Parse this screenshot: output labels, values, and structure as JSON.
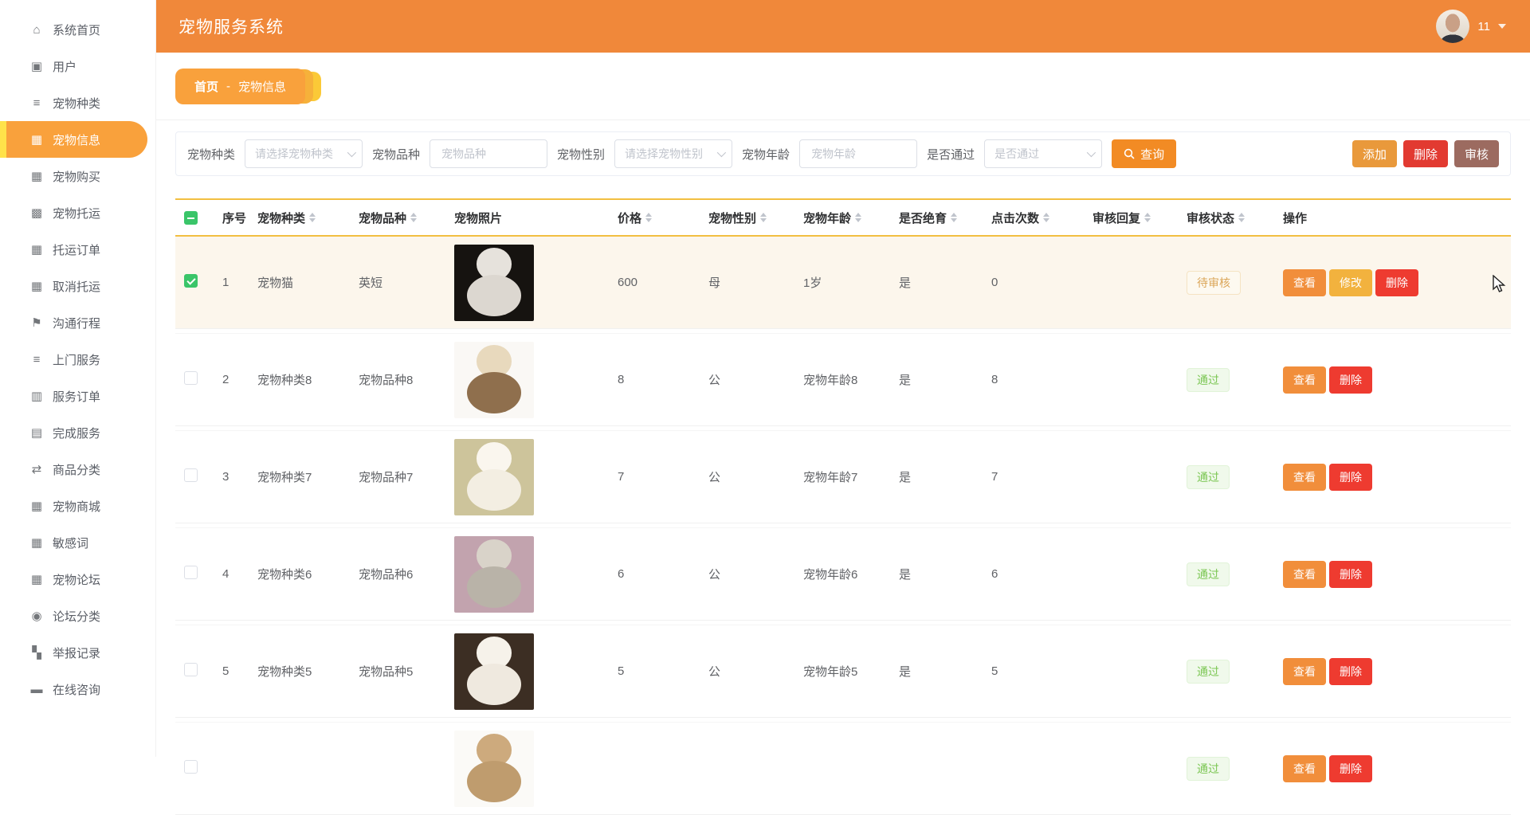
{
  "header": {
    "title": "宠物服务系统",
    "user_name": "11"
  },
  "sidebar": {
    "items": [
      {
        "id": "home",
        "label": "系统首页",
        "icon": "home-icon",
        "glyph": "⌂",
        "active": false
      },
      {
        "id": "users",
        "label": "用户",
        "icon": "user-icon",
        "glyph": "▣",
        "active": false
      },
      {
        "id": "pet-type",
        "label": "宠物种类",
        "icon": "list-icon",
        "glyph": "≡",
        "active": false
      },
      {
        "id": "pet-info",
        "label": "宠物信息",
        "icon": "grid-icon",
        "glyph": "▦",
        "active": true
      },
      {
        "id": "pet-purchase",
        "label": "宠物购买",
        "icon": "grid-icon",
        "glyph": "▦",
        "active": false
      },
      {
        "id": "pet-transport",
        "label": "宠物托运",
        "icon": "grid-dense-icon",
        "glyph": "▩",
        "active": false
      },
      {
        "id": "transport-orders",
        "label": "托运订单",
        "icon": "grid-icon",
        "glyph": "▦",
        "active": false
      },
      {
        "id": "cancel-transport",
        "label": "取消托运",
        "icon": "grid-icon",
        "glyph": "▦",
        "active": false
      },
      {
        "id": "trip-communication",
        "label": "沟通行程",
        "icon": "flag-icon",
        "glyph": "⚑",
        "active": false
      },
      {
        "id": "door-service",
        "label": "上门服务",
        "icon": "list-icon",
        "glyph": "≡",
        "active": false
      },
      {
        "id": "service-orders",
        "label": "服务订单",
        "icon": "chart-icon",
        "glyph": "▥",
        "active": false
      },
      {
        "id": "completed-service",
        "label": "完成服务",
        "icon": "comment-icon",
        "glyph": "▤",
        "active": false
      },
      {
        "id": "goods-category",
        "label": "商品分类",
        "icon": "sliders-icon",
        "glyph": "⇄",
        "active": false
      },
      {
        "id": "pet-mall",
        "label": "宠物商城",
        "icon": "grid-icon",
        "glyph": "▦",
        "active": false
      },
      {
        "id": "sensitive-words",
        "label": "敏感词",
        "icon": "grid-icon",
        "glyph": "▦",
        "active": false
      },
      {
        "id": "pet-forum",
        "label": "宠物论坛",
        "icon": "grid-icon",
        "glyph": "▦",
        "active": false
      },
      {
        "id": "forum-category",
        "label": "论坛分类",
        "icon": "bulb-icon",
        "glyph": "◉",
        "active": false
      },
      {
        "id": "report-records",
        "label": "举报记录",
        "icon": "report-icon",
        "glyph": "▚",
        "active": false
      },
      {
        "id": "online-consult",
        "label": "在线咨询",
        "icon": "briefcase-icon",
        "glyph": "▬",
        "active": false
      }
    ]
  },
  "breadcrumb": {
    "home": "首页",
    "separator": "-",
    "current": "宠物信息"
  },
  "filters": {
    "fields": [
      {
        "label": "宠物种类",
        "control": "select",
        "placeholder": "请选择宠物种类"
      },
      {
        "label": "宠物品种",
        "control": "input",
        "placeholder": "宠物品种"
      },
      {
        "label": "宠物性别",
        "control": "select",
        "placeholder": "请选择宠物性别"
      },
      {
        "label": "宠物年龄",
        "control": "input",
        "placeholder": "宠物年龄"
      },
      {
        "label": "是否通过",
        "control": "select",
        "placeholder": "是否通过"
      }
    ],
    "search_label": "查询"
  },
  "actions": [
    {
      "id": "add",
      "label": "添加"
    },
    {
      "id": "del",
      "label": "删除"
    },
    {
      "id": "review",
      "label": "审核"
    }
  ],
  "table": {
    "columns": [
      {
        "label": "序号",
        "sortable": false
      },
      {
        "label": "宠物种类",
        "sortable": true
      },
      {
        "label": "宠物品种",
        "sortable": true
      },
      {
        "label": "宠物照片",
        "sortable": false
      },
      {
        "label": "价格",
        "sortable": true
      },
      {
        "label": "宠物性别",
        "sortable": true
      },
      {
        "label": "宠物年龄",
        "sortable": true
      },
      {
        "label": "是否绝育",
        "sortable": true
      },
      {
        "label": "点击次数",
        "sortable": true
      },
      {
        "label": "审核回复",
        "sortable": true
      },
      {
        "label": "审核状态",
        "sortable": true
      },
      {
        "label": "操作",
        "sortable": false
      }
    ],
    "rows": [
      {
        "index": "1",
        "type": "宠物猫",
        "breed": "英短",
        "price": "600",
        "gender": "母",
        "age": "1岁",
        "neutered": "是",
        "clicks": "0",
        "reply": "",
        "status": "待审核",
        "status_kind": "pending",
        "checked": true,
        "selected": true,
        "photo": {
          "desc": "gray-white-kitten-on-dark",
          "bg": "#161310",
          "head": "#e6e2dc",
          "body": "#dcd7d0"
        },
        "buttons": [
          {
            "label": "查看",
            "kind": "view"
          },
          {
            "label": "修改",
            "kind": "edit"
          },
          {
            "label": "删除",
            "kind": "delete"
          }
        ]
      },
      {
        "index": "2",
        "type": "宠物种类8",
        "breed": "宠物品种8",
        "price": "8",
        "gender": "公",
        "age": "宠物年龄8",
        "neutered": "是",
        "clicks": "8",
        "reply": "",
        "status": "通过",
        "status_kind": "passed",
        "checked": false,
        "selected": false,
        "photo": {
          "desc": "ferret-on-white",
          "bg": "#faf8f5",
          "head": "#e8d9bd",
          "body": "#8f6f4d"
        },
        "buttons": [
          {
            "label": "查看",
            "kind": "view"
          },
          {
            "label": "删除",
            "kind": "delete"
          }
        ]
      },
      {
        "index": "3",
        "type": "宠物种类7",
        "breed": "宠物品种7",
        "price": "7",
        "gender": "公",
        "age": "宠物年龄7",
        "neutered": "是",
        "clicks": "7",
        "reply": "",
        "status": "通过",
        "status_kind": "passed",
        "checked": false,
        "selected": false,
        "photo": {
          "desc": "white-samoyed-dog-outdoors",
          "bg": "#cdc49b",
          "head": "#faf6ee",
          "body": "#f3eee2"
        },
        "buttons": [
          {
            "label": "查看",
            "kind": "view"
          },
          {
            "label": "删除",
            "kind": "delete"
          }
        ]
      },
      {
        "index": "4",
        "type": "宠物种类6",
        "breed": "宠物品种6",
        "price": "6",
        "gender": "公",
        "age": "宠物年龄6",
        "neutered": "是",
        "clicks": "6",
        "reply": "",
        "status": "通过",
        "status_kind": "passed",
        "checked": false,
        "selected": false,
        "photo": {
          "desc": "tabby-cat-on-mauve",
          "bg": "#c2a3ae",
          "head": "#d9d3c9",
          "body": "#b9b3a8"
        },
        "buttons": [
          {
            "label": "查看",
            "kind": "view"
          },
          {
            "label": "删除",
            "kind": "delete"
          }
        ]
      },
      {
        "index": "5",
        "type": "宠物种类5",
        "breed": "宠物品种5",
        "price": "5",
        "gender": "公",
        "age": "宠物年龄5",
        "neutered": "是",
        "clicks": "5",
        "reply": "",
        "status": "通过",
        "status_kind": "passed",
        "checked": false,
        "selected": false,
        "photo": {
          "desc": "white-pomeranian-on-dark-wood",
          "bg": "#3c2e23",
          "head": "#f6f2ea",
          "body": "#efe9df"
        },
        "buttons": [
          {
            "label": "查看",
            "kind": "view"
          },
          {
            "label": "删除",
            "kind": "delete"
          }
        ]
      },
      {
        "index": "",
        "type": "",
        "breed": "",
        "price": "",
        "gender": "",
        "age": "",
        "neutered": "",
        "clicks": "",
        "reply": "",
        "status": "通过",
        "status_kind": "passed",
        "checked": false,
        "selected": false,
        "photo": {
          "desc": "tan-ferret-partially-visible",
          "bg": "#fbfaf7",
          "head": "#cdaa7d",
          "body": "#bf9c6e"
        },
        "buttons": [
          {
            "label": "查看",
            "kind": "view"
          },
          {
            "label": "删除",
            "kind": "delete"
          }
        ]
      }
    ]
  },
  "colors": {
    "header_orange": "#f0883a",
    "pill_orange": "#f9a13c",
    "accent_yellow": "#ffe24a",
    "table_gold": "#f2bf41",
    "checkbox_green": "#3ac569",
    "selected_row": "#fcf6ec"
  }
}
